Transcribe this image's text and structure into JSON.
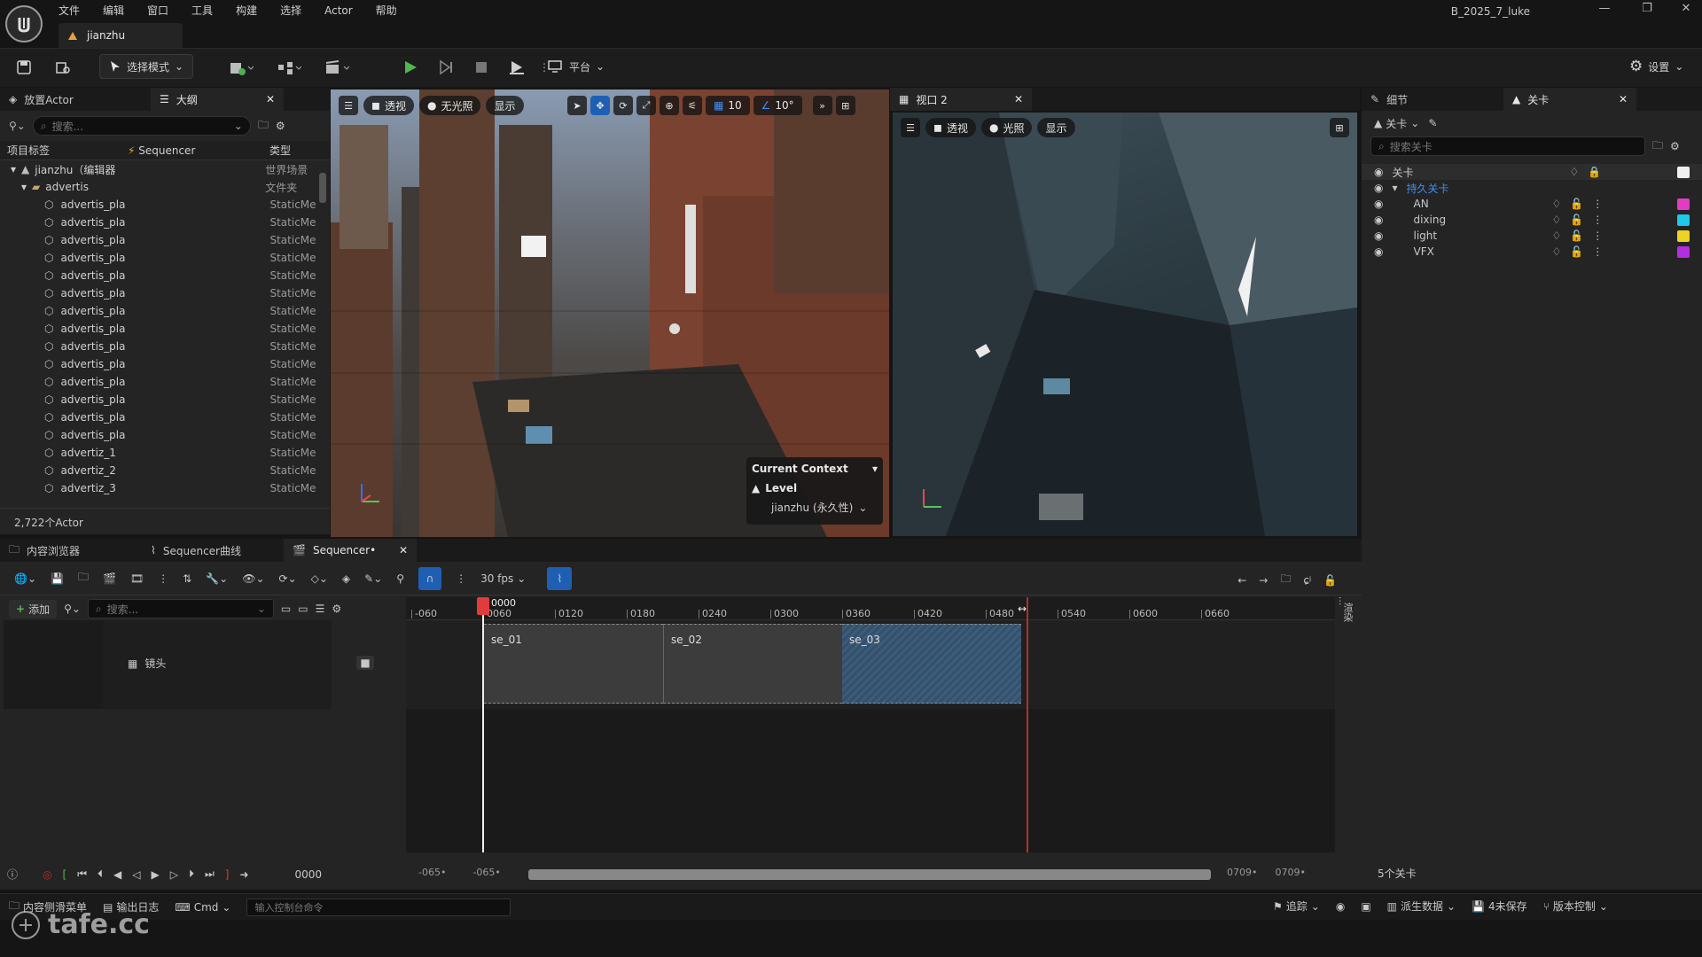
{
  "menubar": {
    "items": [
      "文件",
      "编辑",
      "窗口",
      "工具",
      "构建",
      "选择",
      "Actor",
      "帮助"
    ],
    "project": "B_2025_7_luke"
  },
  "doc_tab": {
    "label": "jianzhu"
  },
  "toolbar": {
    "mode_label": "选择模式",
    "platform_label": "平台",
    "settings_label": "设置"
  },
  "left_panel": {
    "tabs": [
      "放置Actor",
      "大纲"
    ],
    "search_placeholder": "搜索...",
    "columns": {
      "label": "项目标签",
      "sequencer": "Sequencer",
      "type": "类型"
    },
    "root": {
      "label": "jianzhu（编辑器",
      "type": "世界场景"
    },
    "folder": {
      "label": "advertis",
      "type": "文件夹"
    },
    "rows": [
      {
        "label": "advertis_pla",
        "type": "StaticMe"
      },
      {
        "label": "advertis_pla",
        "type": "StaticMe"
      },
      {
        "label": "advertis_pla",
        "type": "StaticMe"
      },
      {
        "label": "advertis_pla",
        "type": "StaticMe"
      },
      {
        "label": "advertis_pla",
        "type": "StaticMe"
      },
      {
        "label": "advertis_pla",
        "type": "StaticMe"
      },
      {
        "label": "advertis_pla",
        "type": "StaticMe"
      },
      {
        "label": "advertis_pla",
        "type": "StaticMe"
      },
      {
        "label": "advertis_pla",
        "type": "StaticMe"
      },
      {
        "label": "advertis_pla",
        "type": "StaticMe"
      },
      {
        "label": "advertis_pla",
        "type": "StaticMe"
      },
      {
        "label": "advertis_pla",
        "type": "StaticMe"
      },
      {
        "label": "advertis_pla",
        "type": "StaticMe"
      },
      {
        "label": "advertis_pla",
        "type": "StaticMe"
      },
      {
        "label": "advertiz_1",
        "type": "StaticMe"
      },
      {
        "label": "advertiz_2",
        "type": "StaticMe"
      },
      {
        "label": "advertiz_3",
        "type": "StaticMe"
      }
    ],
    "count": "2,722个Actor"
  },
  "viewport1": {
    "perspective": "透视",
    "lighting": "无光照",
    "show": "显示",
    "grid_value": "10",
    "angle_value": "10°",
    "context": {
      "title": "Current Context",
      "level_label": "Level",
      "level_value": "jianzhu (永久性)"
    }
  },
  "viewport2": {
    "tab": "视口 2",
    "perspective": "透视",
    "lighting": "光照",
    "show": "显示"
  },
  "right_panel": {
    "tabs": [
      "细节",
      "关卡"
    ],
    "levels_dropdown": "关卡",
    "search_placeholder": "搜索关卡",
    "header": "关卡",
    "persistent": "持久关卡",
    "levels": [
      {
        "name": "AN",
        "color": "#e23cc3"
      },
      {
        "name": "dixing",
        "color": "#1fc7e8"
      },
      {
        "name": "light",
        "color": "#ecd324"
      },
      {
        "name": "VFX",
        "color": "#b22fe0"
      }
    ],
    "count": "5个关卡"
  },
  "bottom_tabs": [
    "内容浏览器",
    "Sequencer曲线",
    "Sequencer•"
  ],
  "sequencer": {
    "fps": "30 fps",
    "add_label": "添加",
    "search_placeholder": "搜索...",
    "track_label": "镜头",
    "current_frame": "0000",
    "ruler": [
      "-060",
      "0060",
      "0120",
      "0180",
      "0240",
      "0300",
      "0360",
      "0420",
      "0480",
      "0540",
      "0600",
      "0660"
    ],
    "sections": [
      "se_01",
      "se_02",
      "se_03"
    ],
    "range_start_a": "-065•",
    "range_start_b": "-065•",
    "range_end_a": "0709•",
    "range_end_b": "0709•",
    "side_label": "渲染"
  },
  "statusbar": {
    "drawer": "内容侧滑菜单",
    "output_log": "输出日志",
    "cmd": "Cmd",
    "console_placeholder": "输入控制台命令",
    "trace": "追踪",
    "derived": "派生数据",
    "unsaved": "4未保存",
    "source_control": "版本控制"
  },
  "watermark": "tafe.cc"
}
